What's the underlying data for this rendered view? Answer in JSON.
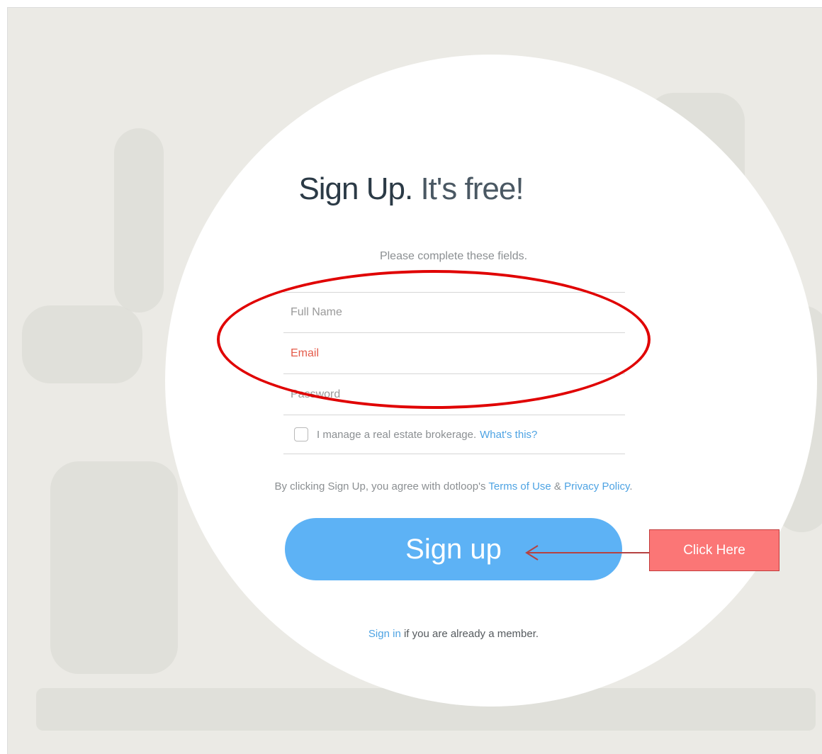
{
  "form": {
    "title_bold": "Sign Up.",
    "title_light": "It's free!",
    "subtitle": "Please complete these fields.",
    "full_name_placeholder": "Full Name",
    "email_placeholder": "Email",
    "password_placeholder": "Password",
    "brokerage_label": "I manage a real estate brokerage.",
    "whats_this_link": "What's this?",
    "terms_prefix": "By clicking Sign Up, you agree with dotloop's",
    "terms_link": "Terms of Use",
    "terms_amp": "&",
    "privacy_link": "Privacy Policy",
    "terms_suffix": ".",
    "signup_button": "Sign up",
    "signin_link": "Sign in",
    "signin_suffix": "if you are already a member."
  },
  "annotation": {
    "callout_text": "Click Here",
    "ellipse_color": "#e00000",
    "callout_color": "#fb7676"
  },
  "colors": {
    "link": "#4ea3e3",
    "button": "#5db2f5",
    "error_text": "#e45b4a"
  }
}
